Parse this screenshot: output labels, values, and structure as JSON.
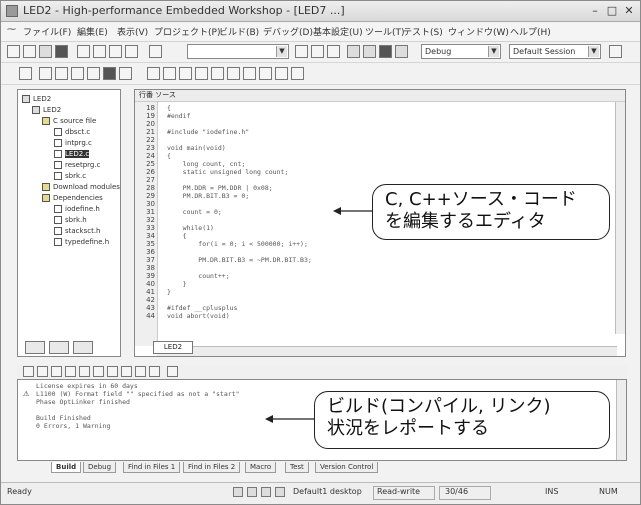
{
  "titlebar": {
    "title": "LED2 - High-performance Embedded Workshop - [LED7 ...]"
  },
  "menu": [
    "ファイル(F)",
    "編集(E)",
    "表示(V)",
    "プロジェクト(P)",
    "ビルド(B)",
    "デバッグ(D)",
    "基本設定(U)",
    "ツール(T)",
    "テスト(S)",
    "ウィンドウ(W)",
    "ヘルプ(H)"
  ],
  "toolbar": {
    "config_combo": "Debug",
    "session_combo": "Default Session"
  },
  "workspace": {
    "tree": [
      {
        "label": "LED2",
        "icon": "workspace-icon"
      },
      {
        "label": "LED2",
        "icon": "project-icon"
      },
      {
        "label": "C source file",
        "icon": "folder-icon"
      },
      {
        "label": "dbsct.c",
        "icon": "file-icon"
      },
      {
        "label": "intprg.c",
        "icon": "file-icon"
      },
      {
        "label": "LED2.c",
        "icon": "file-icon",
        "selected": true
      },
      {
        "label": "resetprg.c",
        "icon": "file-icon"
      },
      {
        "label": "sbrk.c",
        "icon": "file-icon"
      },
      {
        "label": "Download modules",
        "icon": "folder-icon"
      },
      {
        "label": "Dependencies",
        "icon": "folder-icon"
      },
      {
        "label": "iodefine.h",
        "icon": "file-icon"
      },
      {
        "label": "sbrk.h",
        "icon": "file-icon"
      },
      {
        "label": "stacksct.h",
        "icon": "file-icon"
      },
      {
        "label": "typedefine.h",
        "icon": "file-icon"
      }
    ]
  },
  "editor": {
    "header": "行番  ソース",
    "tab": "LED2",
    "lines": [
      {
        "n": "18",
        "text": "{"
      },
      {
        "n": "19",
        "text": "#endif"
      },
      {
        "n": "20",
        "text": ""
      },
      {
        "n": "21",
        "text": "#include \"iodefine.h\""
      },
      {
        "n": "22",
        "text": ""
      },
      {
        "n": "23",
        "text": "void main(void)"
      },
      {
        "n": "24",
        "text": "{"
      },
      {
        "n": "25",
        "text": "    long count, cnt;"
      },
      {
        "n": "26",
        "text": "    static unsigned long count;"
      },
      {
        "n": "27",
        "text": ""
      },
      {
        "n": "28",
        "text": "    PM.DDR = PM.DDR | 0x08;"
      },
      {
        "n": "29",
        "text": "    PM.DR.BIT.B3 = 0;"
      },
      {
        "n": "30",
        "text": ""
      },
      {
        "n": "31",
        "text": "    count = 0;"
      },
      {
        "n": "32",
        "text": ""
      },
      {
        "n": "33",
        "text": "    while(1)"
      },
      {
        "n": "34",
        "text": "    {"
      },
      {
        "n": "35",
        "text": "        for(i = 0; i < 500000; i++);"
      },
      {
        "n": "36",
        "text": ""
      },
      {
        "n": "37",
        "text": "        PM.DR.BIT.B3 = ~PM.DR.BIT.B3;"
      },
      {
        "n": "38",
        "text": ""
      },
      {
        "n": "39",
        "text": "        count++;"
      },
      {
        "n": "40",
        "text": "    }"
      },
      {
        "n": "41",
        "text": "}"
      },
      {
        "n": "42",
        "text": ""
      },
      {
        "n": "43",
        "text": "#ifdef __cplusplus"
      },
      {
        "n": "44",
        "text": "void abort(void)"
      }
    ]
  },
  "callouts": {
    "editor_line1": "C, C++ソース・コード",
    "editor_line2": "を編集するエディタ",
    "build_line1": "ビルド(コンパイル, リンク)",
    "build_line2": "状況をレポートする"
  },
  "output": {
    "lines": [
      "License expires in 60 days",
      "L1100 (W) Format field \"\" specified as not a \"start\"",
      "Phase OptLinker finished",
      "",
      "Build Finished",
      "0 Errors, 1 Warning"
    ],
    "tabs": [
      "Build",
      "Debug",
      "Find in Files 1",
      "Find in Files 2",
      "Macro",
      "Test",
      "Version Control"
    ]
  },
  "status": {
    "ready": "Ready",
    "desktop": "Default1 desktop",
    "mode": "Read-write",
    "position": "30/46",
    "insert": "INS",
    "num": "NUM"
  }
}
